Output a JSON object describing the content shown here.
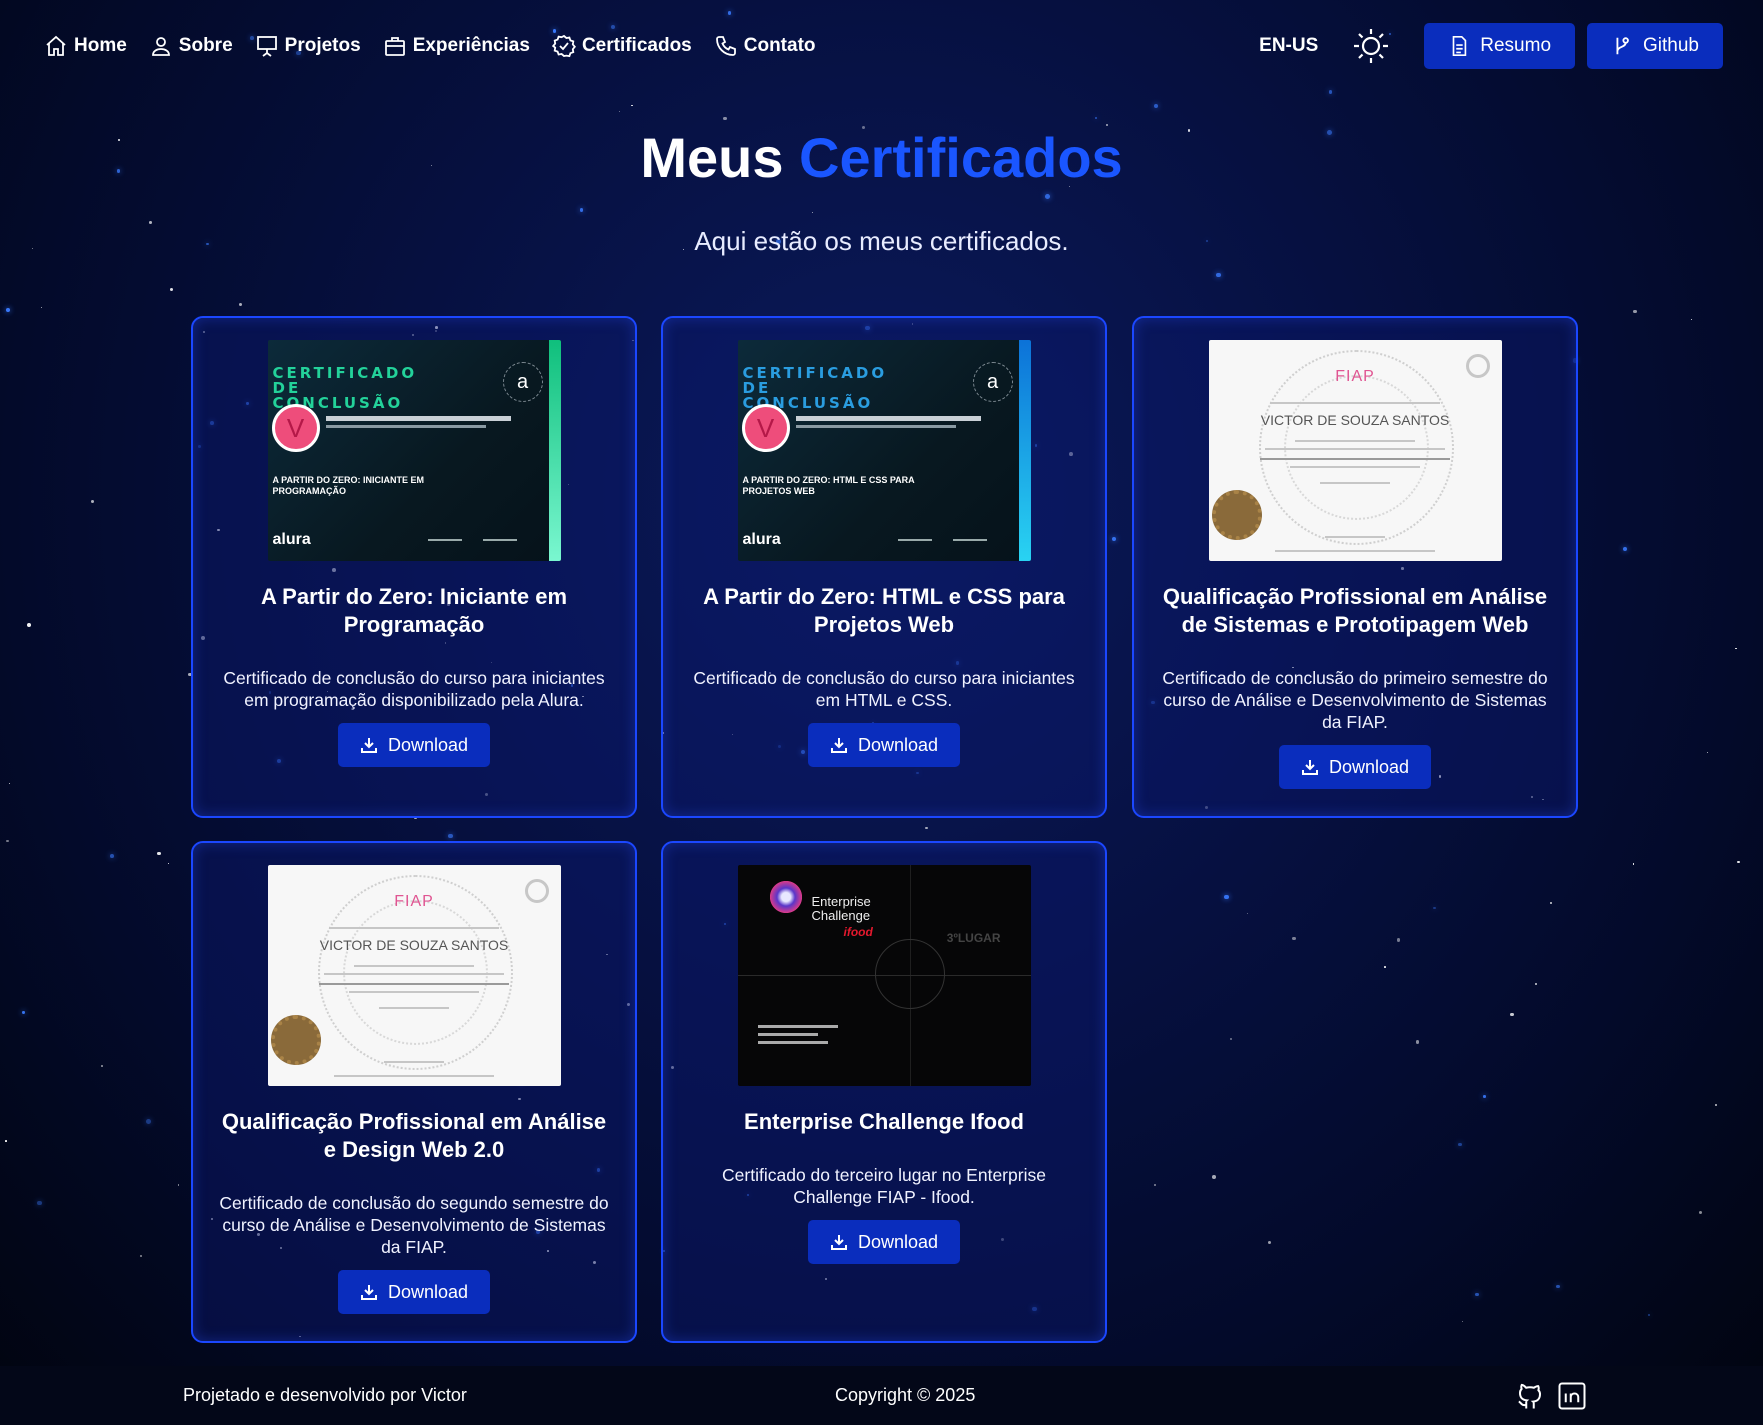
{
  "nav": {
    "items": [
      {
        "label": "Home",
        "icon": "home-icon"
      },
      {
        "label": "Sobre",
        "icon": "user-icon"
      },
      {
        "label": "Projetos",
        "icon": "presentation-icon"
      },
      {
        "label": "Experiências",
        "icon": "briefcase-icon"
      },
      {
        "label": "Certificados",
        "icon": "badge-check-icon"
      },
      {
        "label": "Contato",
        "icon": "phone-icon"
      }
    ],
    "lang": "EN-US",
    "resume_label": "Resumo",
    "github_label": "Github"
  },
  "header": {
    "title_part1": "Meus",
    "title_part2": "Certificados",
    "subtitle": "Aqui estão os meus certificados."
  },
  "certificates": [
    {
      "title": "A Partir do Zero: Iniciante em Programação",
      "description": "Certificado de conclusão do curso para iniciantes em programação disponibilizado pela Alura.",
      "button": "Download",
      "thumb": {
        "type": "alura",
        "header": "CERTIFICADO DE CONCLUSÃO",
        "initial": "V",
        "course": "A PARTIR DO ZERO: INICIANTE EM PROGRAMAÇÃO",
        "accent": "#20d39a",
        "logo": "alura",
        "badge": "a"
      }
    },
    {
      "title": "A Partir do Zero: HTML e CSS para Projetos Web",
      "description": "Certificado de conclusão do curso para iniciantes em HTML e CSS.",
      "button": "Download",
      "thumb": {
        "type": "alura",
        "header": "CERTIFICADO DE CONCLUSÃO",
        "initial": "V",
        "course": "A PARTIR DO ZERO: HTML E CSS PARA PROJETOS WEB",
        "accent": "#1ab3e8",
        "logo": "alura",
        "badge": "a"
      }
    },
    {
      "title": "Qualificação Profissional em Análise de Sistemas e Prototipagem Web",
      "description": "Certificado de conclusão do primeiro semestre do curso de Análise e Desenvolvimento de Sistemas da FIAP.",
      "button": "Download",
      "thumb": {
        "type": "fiap",
        "brand": "FIAP",
        "name": "VICTOR DE SOUZA SANTOS"
      }
    },
    {
      "title": "Qualificação Profissional em Análise e Design Web 2.0",
      "description": "Certificado de conclusão do segundo semestre do curso de Análise e Desenvolvimento de Sistemas da FIAP.",
      "button": "Download",
      "thumb": {
        "type": "fiap",
        "brand": "FIAP",
        "name": "VICTOR DE SOUZA SANTOS"
      }
    },
    {
      "title": "Enterprise Challenge Ifood",
      "description": "Certificado do terceiro lugar no Enterprise Challenge FIAP - Ifood.",
      "button": "Download",
      "thumb": {
        "type": "ec",
        "line1": "Enterprise",
        "line2": "Challenge",
        "brand2": "ifood",
        "place": "3ºLUGAR"
      }
    }
  ],
  "footer": {
    "left": "Projetado e desenvolvido por Victor",
    "center": "Copyright © 2025"
  },
  "colors": {
    "accent": "#1a56ff",
    "button_bg": "#0a2dbd",
    "card_border": "#1b47ff"
  }
}
